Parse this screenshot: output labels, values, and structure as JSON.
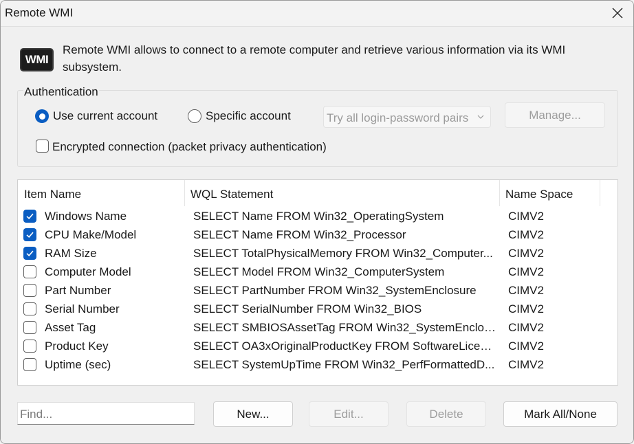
{
  "window": {
    "title": "Remote WMI"
  },
  "intro": {
    "logo_text": "WMI",
    "text": "Remote WMI allows to connect to a remote computer and retrieve various information via its WMI subsystem."
  },
  "auth": {
    "label": "Authentication",
    "radio_current": "Use current account",
    "radio_specific": "Specific account",
    "selected": "Use current account",
    "combo_value": "Try all login-password pairs",
    "manage_label": "Manage...",
    "encrypted_label": "Encrypted connection (packet privacy authentication)",
    "encrypted_checked": false
  },
  "table": {
    "headers": {
      "name": "Item Name",
      "wql": "WQL Statement",
      "ns": "Name Space"
    },
    "rows": [
      {
        "checked": true,
        "name": "Windows Name",
        "wql": "SELECT Name FROM Win32_OperatingSystem",
        "ns": "CIMV2"
      },
      {
        "checked": true,
        "name": "CPU Make/Model",
        "wql": "SELECT Name FROM Win32_Processor",
        "ns": "CIMV2"
      },
      {
        "checked": true,
        "name": "RAM Size",
        "wql": "SELECT TotalPhysicalMemory FROM Win32_Computer...",
        "ns": "CIMV2"
      },
      {
        "checked": false,
        "name": "Computer Model",
        "wql": "SELECT Model FROM Win32_ComputerSystem",
        "ns": "CIMV2"
      },
      {
        "checked": false,
        "name": "Part Number",
        "wql": "SELECT PartNumber FROM Win32_SystemEnclosure",
        "ns": "CIMV2"
      },
      {
        "checked": false,
        "name": "Serial Number",
        "wql": "SELECT SerialNumber FROM Win32_BIOS",
        "ns": "CIMV2"
      },
      {
        "checked": false,
        "name": "Asset Tag",
        "wql": "SELECT SMBIOSAssetTag FROM Win32_SystemEnclos...",
        "ns": "CIMV2"
      },
      {
        "checked": false,
        "name": "Product Key",
        "wql": "SELECT OA3xOriginalProductKey FROM SoftwareLicen...",
        "ns": "CIMV2"
      },
      {
        "checked": false,
        "name": "Uptime (sec)",
        "wql": "SELECT SystemUpTime FROM Win32_PerfFormattedD...",
        "ns": "CIMV2"
      }
    ]
  },
  "footer": {
    "find_placeholder": "Find...",
    "new_label": "New...",
    "edit_label": "Edit...",
    "delete_label": "Delete",
    "markall_label": "Mark All/None"
  },
  "colors": {
    "accent": "#0a5dc2",
    "disabled_text": "#9d9d9d"
  }
}
